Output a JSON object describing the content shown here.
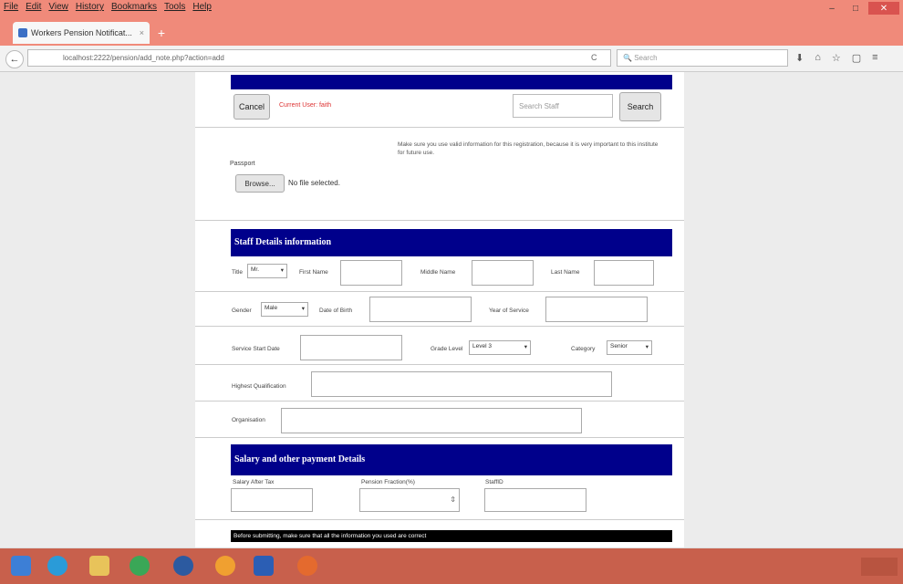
{
  "menu": [
    "File",
    "Edit",
    "View",
    "History",
    "Bookmarks",
    "Tools",
    "Help"
  ],
  "window_controls": [
    "–",
    "□",
    "✕"
  ],
  "tab": {
    "title": "Workers Pension Notificat...",
    "close": "×",
    "new_tab": "+"
  },
  "urlbar": {
    "url": "localhost:2222/pension/add_note.php?action=add",
    "reload": "C"
  },
  "searchbar": {
    "placeholder": "Search"
  },
  "nav_icons": [
    "⬇",
    "⌂",
    "☆",
    "▢",
    "≡"
  ],
  "header": {
    "cancel_label": "Cancel",
    "current_user": "Current User: faith",
    "search_placeholder": "Search Staff",
    "search_label": "Search"
  },
  "passport": {
    "notice": "Make sure you use valid information for this registration, because it is very important to this institute for future use.",
    "label": "Passport",
    "browse_label": "Browse...",
    "file_status": "No file selected."
  },
  "staff_section": {
    "title": "Staff Details information",
    "title_label": "Title",
    "title_value": "Mr.",
    "first_name_label": "First Name",
    "middle_name_label": "Middle Name",
    "last_name_label": "Last Name",
    "gender_label": "Gender",
    "gender_value": "Male",
    "dob_label": "Date of Birth",
    "years_label": "Year of Service",
    "service_start_label": "Service Start Date",
    "grade_label": "Grade Level",
    "grade_value": "Level 3",
    "category_label": "Category",
    "category_value": "Senior",
    "qualification_label": "Highest Qualification",
    "organisation_label": "Organisation"
  },
  "salary_section": {
    "title": "Salary and other payment Details",
    "salary_label": "Salary After Tax",
    "pension_label": "Pension Fraction(%)",
    "staff_id_label": "StaffID"
  },
  "footer_notice": "Before submitting, make sure that all the information you used are correct"
}
